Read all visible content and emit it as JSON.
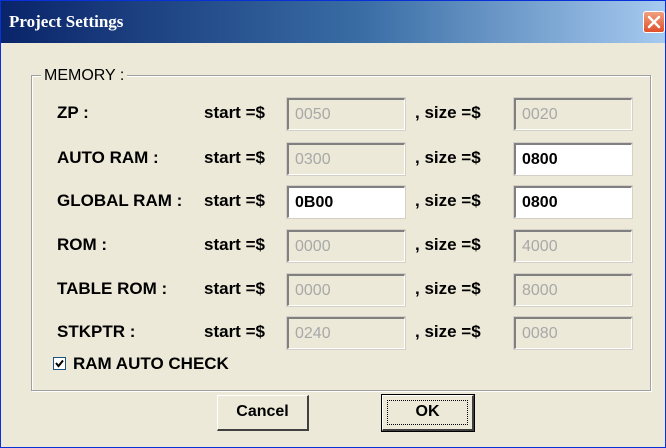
{
  "window": {
    "title": "Project Settings"
  },
  "group": {
    "legend": "MEMORY :"
  },
  "labels": {
    "start": "start =$",
    "size": ", size =$"
  },
  "rows": [
    {
      "name": "ZP :",
      "start": "0050",
      "size": "0020",
      "start_editable": false,
      "size_editable": false
    },
    {
      "name": "AUTO RAM :",
      "start": "0300",
      "size": "0800",
      "start_editable": false,
      "size_editable": true
    },
    {
      "name": "GLOBAL RAM :",
      "start": "0B00",
      "size": "0800",
      "start_editable": true,
      "size_editable": true
    },
    {
      "name": "ROM :",
      "start": "0000",
      "size": "4000",
      "start_editable": false,
      "size_editable": false
    },
    {
      "name": "TABLE ROM :",
      "start": "0000",
      "size": "8000",
      "start_editable": false,
      "size_editable": false
    },
    {
      "name": "STKPTR :",
      "start": "0240",
      "size": "0080",
      "start_editable": false,
      "size_editable": false
    }
  ],
  "checkbox": {
    "label": "RAM AUTO CHECK",
    "checked": true
  },
  "buttons": {
    "cancel": "Cancel",
    "ok": "OK"
  },
  "colors": {
    "titlebar_start": "#0a246a",
    "dialog_bg": "#ece9d8",
    "close": "#e0502a"
  }
}
